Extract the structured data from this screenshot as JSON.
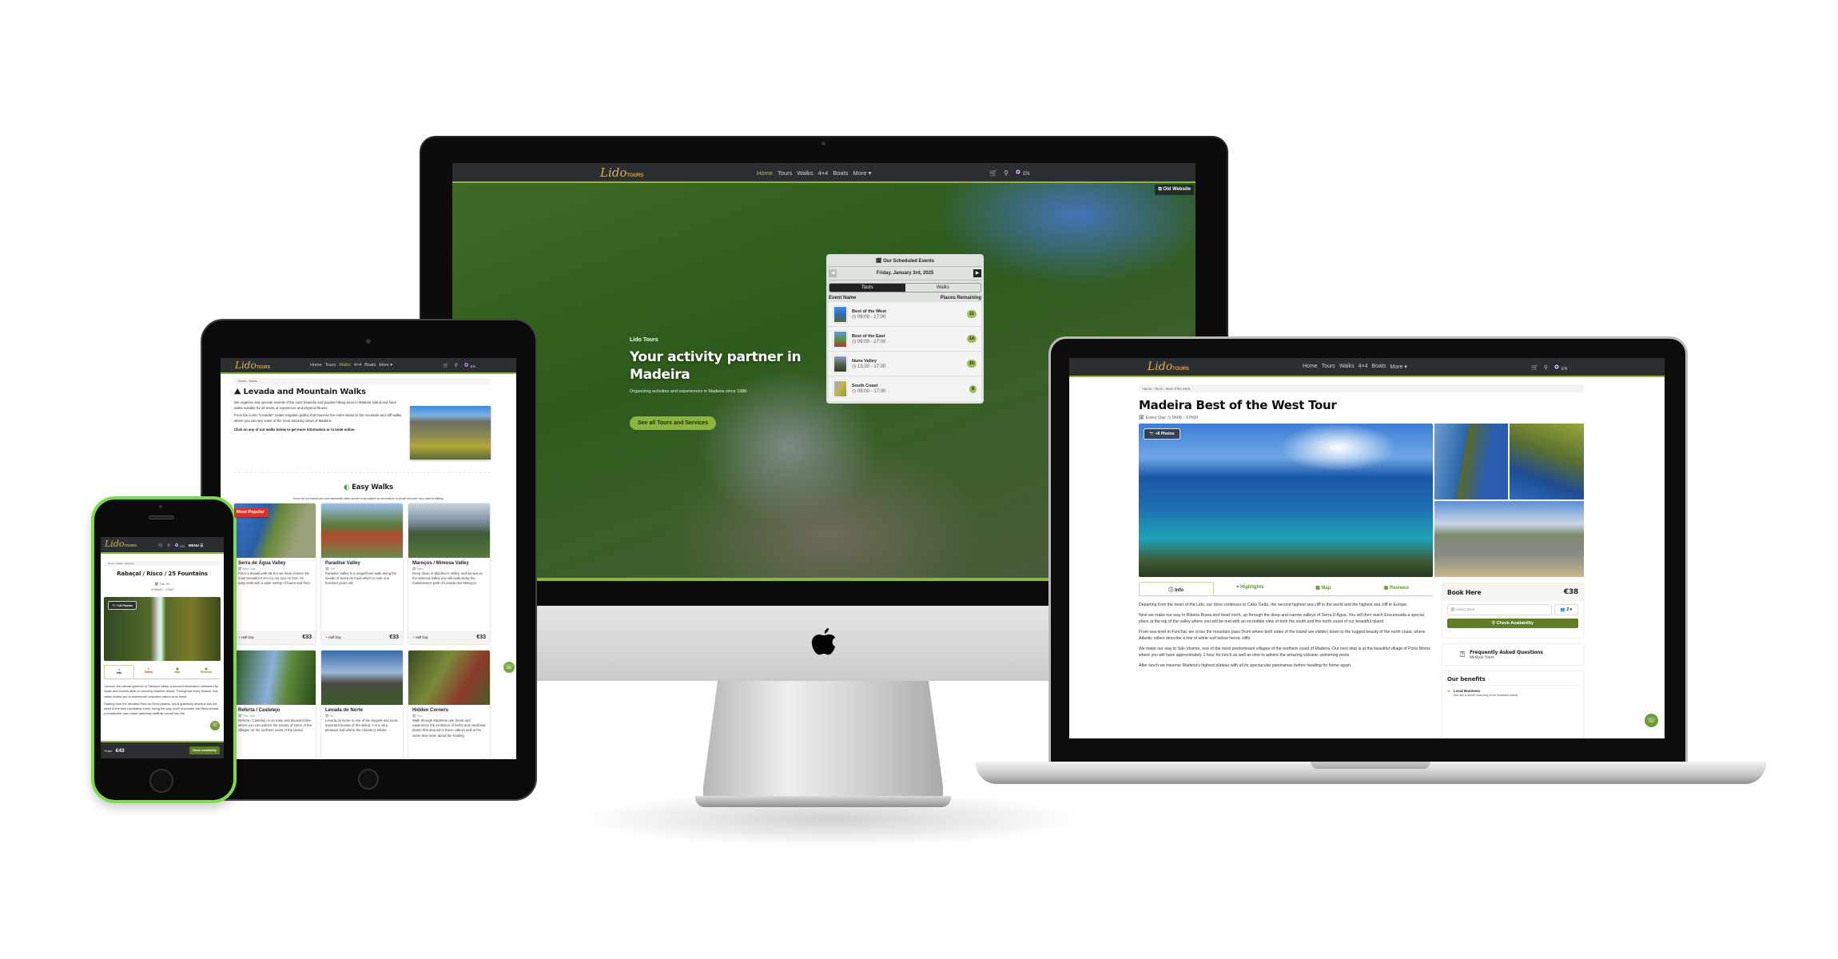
{
  "colors": {
    "accent_green": "#8cb63c",
    "nav_bg": "#2c2f31",
    "logo_gold": "#d8b35a",
    "button_olive": "#5f7d25",
    "phone_frame": "#7fd94f"
  },
  "nav": {
    "logo_script": "Lido",
    "logo_caps": "TOURS",
    "links": [
      "Home",
      "Tours",
      "Walks",
      "4×4",
      "Boats",
      "More ▾"
    ],
    "lang": "EN",
    "icons": [
      "cart-icon",
      "search-icon",
      "flag-uk-icon"
    ],
    "menu": "MENU ☰"
  },
  "imac": {
    "active_link": "Home",
    "old_website": "⧉ Old Website",
    "hero": {
      "kicker": "Lido Tours",
      "title": "Your activity partner in Madeira",
      "subtitle": "Organizing activities and experiences in Madeira since 1986",
      "cta": "See all Tours and Services"
    },
    "events": {
      "title": "Our Scheduled Events",
      "date": "Friday, January 3rd, 2025",
      "tabs": [
        "Tours",
        "Walks"
      ],
      "active_tab": "Tours",
      "col_name": "Event Name",
      "col_places": "Places Remaining",
      "rows": [
        {
          "name": "Best of the West",
          "time": "09:00 - 17:00",
          "places": "11"
        },
        {
          "name": "Best of the East",
          "time": "09:00 - 17:00",
          "places": "14"
        },
        {
          "name": "Nuns Valley",
          "time": "13:30 - 17:00",
          "places": "15"
        },
        {
          "name": "South Coast",
          "time": "09:00 - 17:00",
          "places": "8"
        }
      ]
    }
  },
  "laptop": {
    "breadcrumb": [
      "Home",
      "Tours",
      "Best of the West"
    ],
    "title": "Madeira Best of the West Tour",
    "schedule": "Every Day",
    "hours": "9h00 - 17h00",
    "photos_button": "+8 Photos",
    "tabs": [
      "Info",
      "Highlights",
      "Map",
      "Reviews"
    ],
    "active_tab": "Info",
    "paragraphs": [
      "Departing from the heart of the Lido, our drive continues to Cabo Girão, the second highest sea cliff in the world and the highest sea cliff in Europe.",
      "Next we make our way to Ribeira Brava and head north, up through the deep and narrow valleys of Serra D'Água. You will then reach Encumeada a special place at the top of the valley where you will be met with an incredible view of both the south and the north coast of our beautiful island.",
      "From sea-level in Funchal, we cross the mountain pass (from where both sides of the island are visible) down to the rugged beauty of the north coast, where Atlantic rollers describe a line of white surf below heroic cliffs.",
      "We make our way to São Vicente, one of the most predominant villages of the northern coast of Madeira. Our next stop is at the beautiful village of Porto Moniz where you will have approximately 1 hour for lunch as well as time to admire the amazing volcanic swimming pools.",
      "After lunch we traverse Madeira's highest plateau with all its spectacular panoramas before heading for home again."
    ],
    "booking": {
      "title": "Book Here",
      "price": "€38",
      "date_placeholder": "Select Date",
      "people": "2",
      "check": "Check Availability"
    },
    "faq": {
      "title": "Frequently Asked Questions",
      "subtitle": "Minibus Tours"
    },
    "benefits": {
      "title": "Our benefits",
      "item_title": "Local Business",
      "item_text": "We are a small company from Madeira island"
    }
  },
  "tablet": {
    "active_link": "Walks",
    "breadcrumb": [
      "Home",
      "Walks"
    ],
    "title": "Levada and Mountain Walks",
    "intro": [
      "We organize and operate several of the most beautiful and popular hiking tours in Madeira Island and have walks suitable for all levels of experience and physical fitness.",
      "From the iconic \"Levadas\" (water irrigation paths) that traverse the entire island to the mountain and cliff walks where you can see some of the most amazing views of Madeira."
    ],
    "cta_text": "Click on any of our walks below to get more information or to book online.",
    "section_title": "Easy Walks",
    "section_subtitle": "These are our easiest and most accessible walks and are most suitable for new visitors or people that aren't very used to walking.",
    "ribbon": "Most Popular",
    "cards": [
      {
        "title": "Serra de Água Valley",
        "days": "Mon, Sat",
        "text": "From a levada with 65 Km we have chosen the most beautiful 5 Km for our tour on foot. An easy walk with a wide variety of fauna and flora.",
        "duration": "Half Day",
        "price": "€33"
      },
      {
        "title": "Paradise Valley",
        "days": "Tue",
        "text": "Paradise Valley is a magnificent walk along the levada of Serra do Faial which is over one hundred years old.",
        "duration": "Half Day",
        "price": "€33"
      },
      {
        "title": "Maroços / Mimosa Valley",
        "days": "Wed",
        "text": "Deep down in Machico's Valley, well known as the Mimosa Valley you will walk along the maintenance path of Levada dos Maroços",
        "duration": "Half Day",
        "price": "€33"
      },
      {
        "title": "Referta / Castelejo",
        "days": "Thu, Sun",
        "text": "Referta / Castelejo is an easy and pleasant hike where you can admire the beauty of some of the villages on the northern coast of the island."
      },
      {
        "title": "Levada do Norte",
        "days": "Fri",
        "text": "Levada do Norte is one of the longest and most important levada of the island, it is a very pleasant trail where the climate is milder."
      },
      {
        "title": "Hidden Corners",
        "days": "Sun",
        "text": "Walk through Madeiras rain forest and experience the profusion of herbs and medicinal plants that abound in these valleys and at the same time learn about the healing"
      }
    ]
  },
  "phone": {
    "breadcrumb": [
      "Home",
      "Walks",
      "Rabaçal"
    ],
    "title": "Rabaçal / Risco / 25 Fountains",
    "days": "Tue, Fri",
    "hours": "09h00 - 17h00",
    "photos_button": "+18 Photos",
    "tabs": [
      "Info",
      "Safety",
      "Map",
      "Reviews"
    ],
    "paragraphs": [
      "Uncover the natural splendor of Rabaçal Valley, a beloved destination cherished by locals and tourists alike on stunning Madeira Island. Throughout every season, this valley invites you to experience unspoiled nature at its finest.",
      "Starting from the elevated Paul da Serra plateau, you'll gracefully descend into the heart of the lush Laurissilva forest. Along the way, you'll encounter the Risco levada, a remarkable man-made waterway skillfully carved into the"
    ],
    "from_label": "From",
    "price": "€43",
    "check": "Check Availability"
  }
}
